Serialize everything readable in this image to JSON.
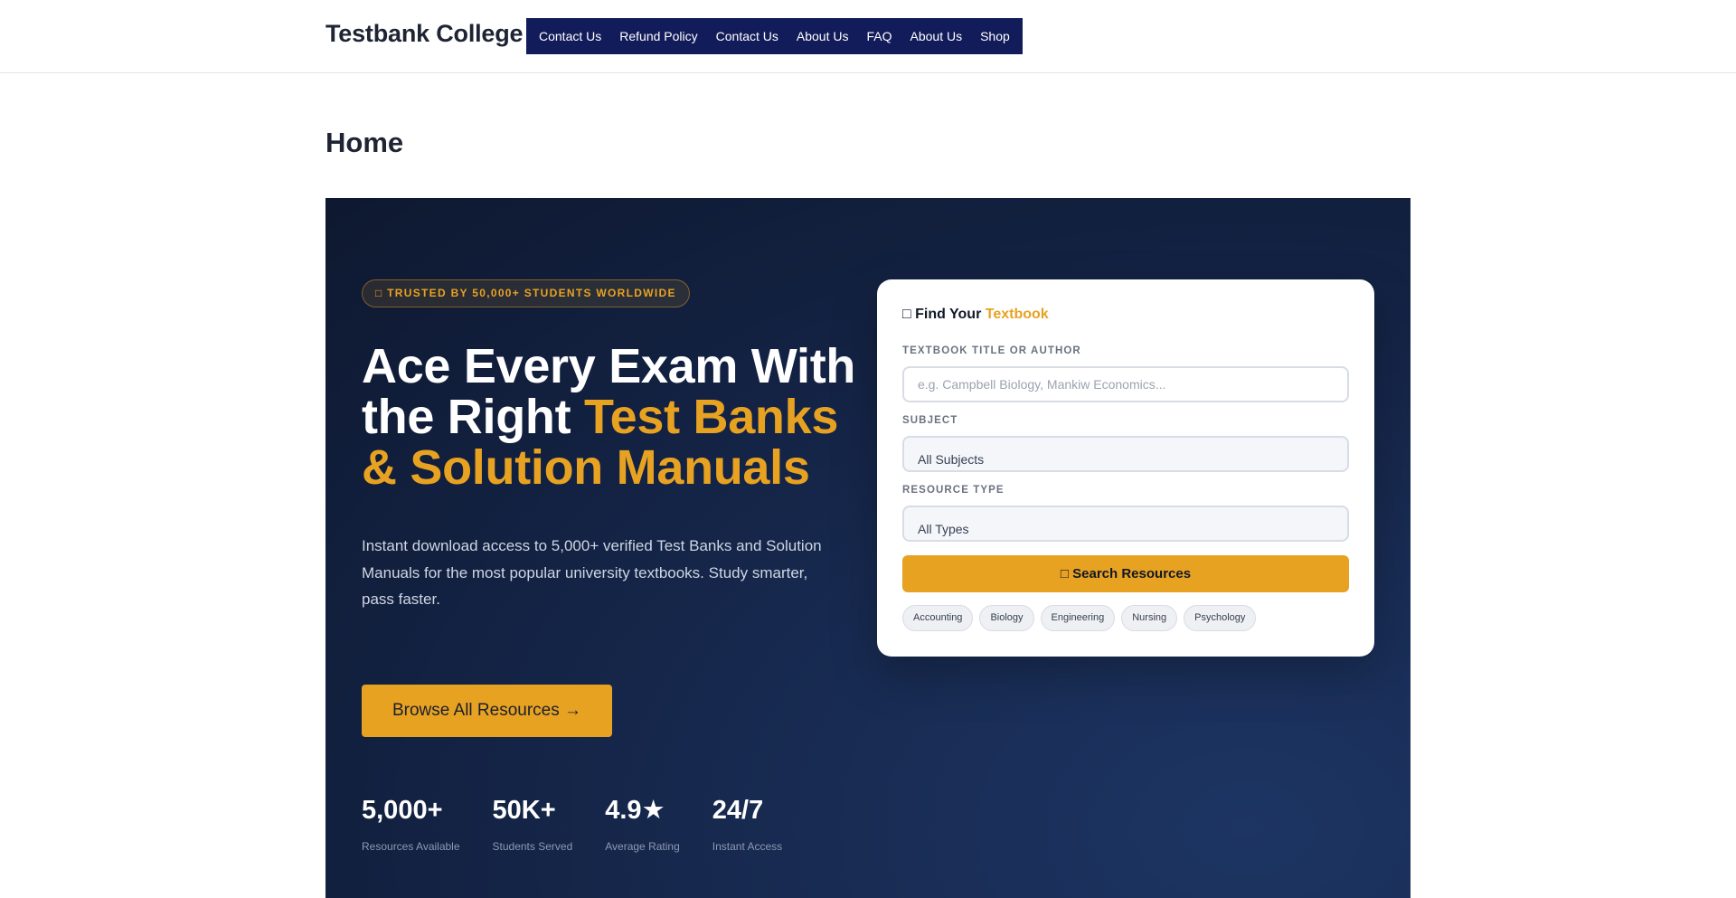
{
  "header": {
    "site_title": "Testbank College",
    "nav": [
      "Contact Us",
      "Refund Policy",
      "Contact Us",
      "About Us",
      "FAQ",
      "About Us",
      "Shop"
    ]
  },
  "page": {
    "title": "Home"
  },
  "hero": {
    "badge": "□ TRUSTED BY 50,000+ STUDENTS WORLDWIDE",
    "heading_white": "Ace Every Exam With the Right ",
    "heading_accent": "Test Banks & Solution Manuals",
    "description": "Instant download access to 5,000+ verified Test Banks and Solution Manuals for the most popular university textbooks. Study smarter, pass faster.",
    "cta_label": "Browse All Resources →",
    "stats": [
      {
        "value": "5,000+",
        "label": "Resources Available"
      },
      {
        "value": "50K+",
        "label": "Students Served"
      },
      {
        "value": "4.9★",
        "label": "Average Rating"
      },
      {
        "value": "24/7",
        "label": "Instant Access"
      }
    ]
  },
  "search_card": {
    "title_icon": "□",
    "title_plain": "Find Your ",
    "title_accent": "Textbook",
    "title_label": "TEXTBOOK TITLE OR AUTHOR",
    "title_placeholder": "e.g. Campbell Biology, Mankiw Economics...",
    "subject_label": "SUBJECT",
    "subject_value": "All Subjects",
    "type_label": "RESOURCE TYPE",
    "type_value": "All Types",
    "search_button": "□ Search Resources",
    "chips": [
      "Accounting",
      "Biology",
      "Engineering",
      "Nursing",
      "Psychology"
    ]
  },
  "colors": {
    "accent": "#e8a222",
    "nav_bg": "#131c5a",
    "hero_bg": "#14254a"
  }
}
